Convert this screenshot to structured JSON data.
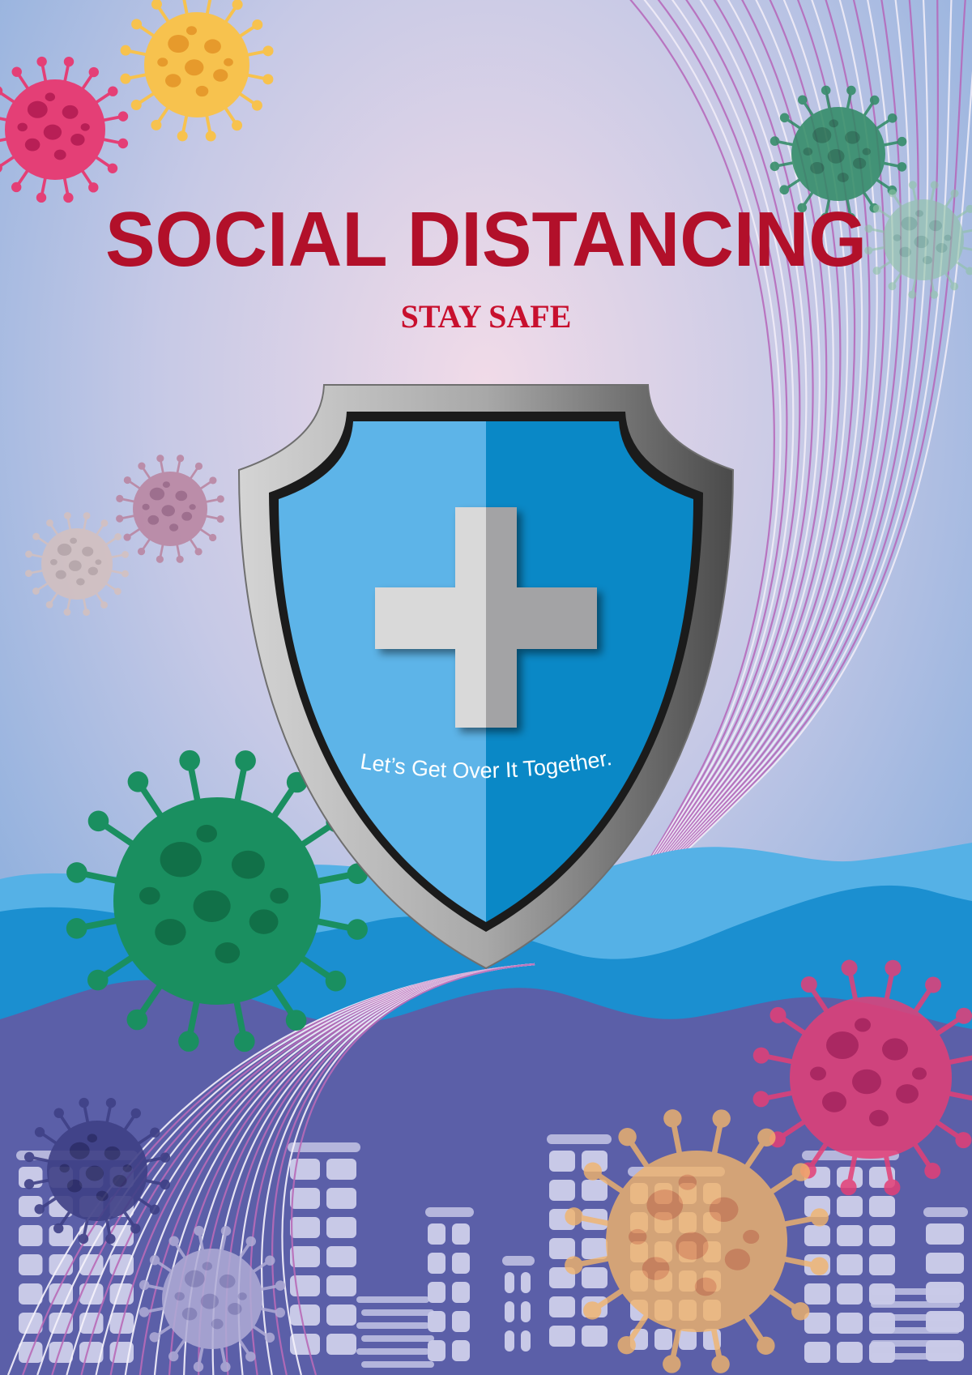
{
  "poster": {
    "title": "SOCIAL DISTANCING",
    "subtitle": "STAY SAFE",
    "tagline": "Let’s Get Over It Together."
  },
  "icons": [
    "virus-icon",
    "shield-icon",
    "medical-cross-icon",
    "city-skyline",
    "swoosh-lines"
  ],
  "colors": {
    "title": "#b2102a",
    "subtitle": "#c8102e",
    "shield_left": "#5db4e8",
    "shield_right": "#0a88c6",
    "shield_frame": "#9a9a9a",
    "hills_blue": "#1b8fd0",
    "hills_purple": "#5b5fa8",
    "virus_pink": "#e43f76",
    "virus_yellow": "#f7c24e",
    "virus_green": "#1a8f60"
  }
}
